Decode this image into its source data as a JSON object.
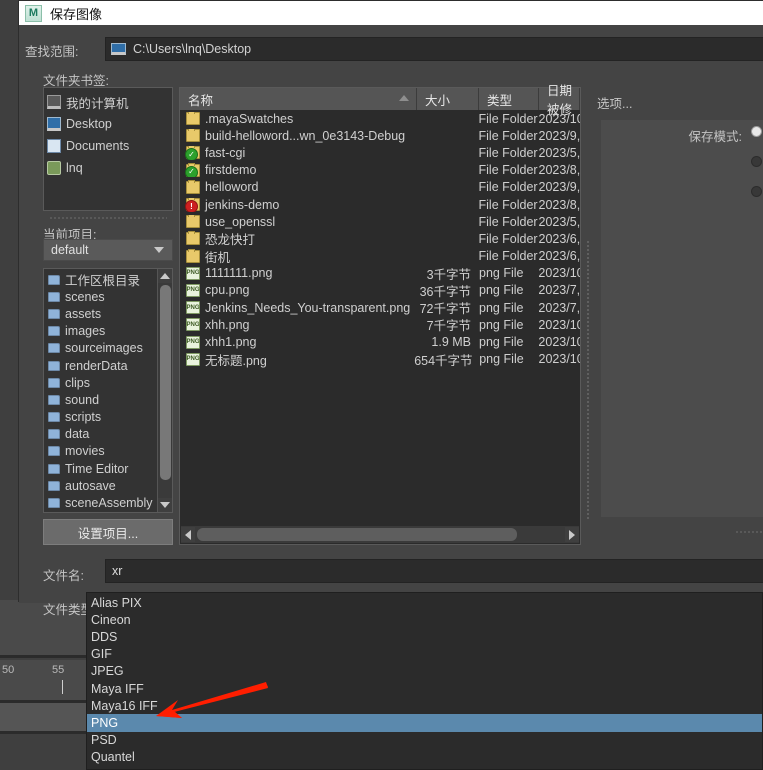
{
  "window": {
    "title": "保存图像",
    "logo_icon": "maya-logo-icon",
    "logo_text": "M"
  },
  "lookin": {
    "label": "查找范围:",
    "icon": "desktop-monitor-icon",
    "path": "C:\\Users\\lnq\\Desktop"
  },
  "bookmarks": {
    "label": "文件夹书签:",
    "items": [
      {
        "label": "我的计算机",
        "icon": "computer-icon"
      },
      {
        "label": "Desktop",
        "icon": "desktop-icon"
      },
      {
        "label": "Documents",
        "icon": "documents-icon"
      },
      {
        "label": "lnq",
        "icon": "user-icon"
      }
    ]
  },
  "project": {
    "label": "当前项目:",
    "value": "default",
    "dropdown_icon": "chevron-down-icon"
  },
  "folders": {
    "items": [
      "工作区根目录",
      "scenes",
      "assets",
      "images",
      "sourceimages",
      "renderData",
      "clips",
      "sound",
      "scripts",
      "data",
      "movies",
      "Time Editor",
      "autosave",
      "sceneAssembly"
    ],
    "scroll_up_icon": "chevron-up-icon",
    "scroll_down_icon": "chevron-down-icon"
  },
  "set_project_button": "设置项目...",
  "file_list": {
    "columns": {
      "name": "名称",
      "size": "大小",
      "type": "类型",
      "date": "日期被修"
    },
    "sort_icon": "sort-ascending-icon",
    "rows": [
      {
        "name": ".mayaSwatches",
        "icon": "folder-icon",
        "badge": "",
        "size": "",
        "type": "File Folder",
        "date": "2023/10"
      },
      {
        "name": "build-helloword...wn_0e3143-Debug",
        "icon": "folder-icon",
        "badge": "",
        "size": "",
        "type": "File Folder",
        "date": "2023/9,"
      },
      {
        "name": "fast-cgi",
        "icon": "folder-icon",
        "badge": "ok",
        "size": "",
        "type": "File Folder",
        "date": "2023/5,"
      },
      {
        "name": "firstdemo",
        "icon": "folder-icon",
        "badge": "ok",
        "size": "",
        "type": "File Folder",
        "date": "2023/8,"
      },
      {
        "name": "helloword",
        "icon": "folder-icon",
        "badge": "",
        "size": "",
        "type": "File Folder",
        "date": "2023/9,"
      },
      {
        "name": "jenkins-demo",
        "icon": "folder-icon",
        "badge": "err",
        "size": "",
        "type": "File Folder",
        "date": "2023/8,"
      },
      {
        "name": "use_openssl",
        "icon": "folder-icon",
        "badge": "",
        "size": "",
        "type": "File Folder",
        "date": "2023/5,"
      },
      {
        "name": "恐龙快打",
        "icon": "folder-icon",
        "badge": "",
        "size": "",
        "type": "File Folder",
        "date": "2023/6,"
      },
      {
        "name": "街机",
        "icon": "folder-icon",
        "badge": "",
        "size": "",
        "type": "File Folder",
        "date": "2023/6,"
      },
      {
        "name": "1111111.png",
        "icon": "png-file-icon",
        "badge": "",
        "size": "3千字节",
        "type": "png File",
        "date": "2023/10"
      },
      {
        "name": "cpu.png",
        "icon": "png-file-icon",
        "badge": "",
        "size": "36千字节",
        "type": "png File",
        "date": "2023/7,"
      },
      {
        "name": "Jenkins_Needs_You-transparent.png",
        "icon": "png-file-icon",
        "badge": "",
        "size": "72千字节",
        "type": "png File",
        "date": "2023/7,"
      },
      {
        "name": "xhh.png",
        "icon": "png-file-icon",
        "badge": "",
        "size": "7千字节",
        "type": "png File",
        "date": "2023/10"
      },
      {
        "name": "xhh1.png",
        "icon": "png-file-icon",
        "badge": "",
        "size": "1.9 MB",
        "type": "png File",
        "date": "2023/10"
      },
      {
        "name": "无标题.png",
        "icon": "png-file-icon",
        "badge": "",
        "size": "654千字节",
        "type": "png File",
        "date": "2023/10"
      }
    ],
    "scroll_left_icon": "triangle-left-icon",
    "scroll_right_icon": "triangle-right-icon"
  },
  "options": {
    "label": "选项...",
    "save_mode_label": "保存模式:",
    "radios": [
      "selected",
      "unselected",
      "unselected"
    ]
  },
  "filename": {
    "label": "文件名:",
    "value": "xr"
  },
  "filetype": {
    "label": "文件类型:",
    "value": "PNG",
    "options": [
      "Alias PIX",
      "Cineon",
      "DDS",
      "GIF",
      "JPEG",
      "Maya IFF",
      "Maya16 IFF",
      "PNG",
      "PSD",
      "Quantel"
    ],
    "selected": "PNG"
  },
  "background": {
    "timeline_ticks": [
      "50",
      "55"
    ]
  },
  "colors": {
    "dialog_bg": "#444444",
    "field_bg": "#2b2b2b",
    "highlight": "#5b89ad",
    "accent_arrow": "#ff1e00",
    "folder_icon": "#e8c96a",
    "text": "#d0d0d0"
  }
}
